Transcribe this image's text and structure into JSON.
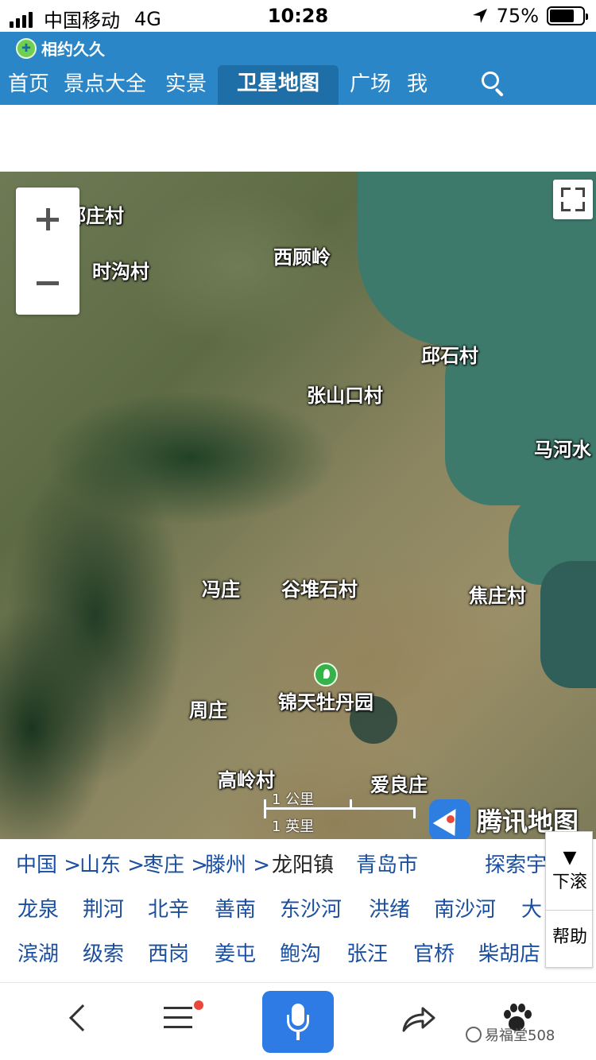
{
  "status_bar": {
    "carrier": "中国移动",
    "network": "4G",
    "time": "10:28",
    "battery_text": "75%",
    "battery_level": 0.75,
    "icons": [
      "signal-icon",
      "location-arrow-icon",
      "battery-icon"
    ]
  },
  "header": {
    "brand": "相约久久",
    "nav": [
      {
        "label": "首页"
      },
      {
        "label": "景点大全"
      },
      {
        "label": "实景"
      },
      {
        "label": "卫星地图",
        "active": true
      },
      {
        "label": "广场"
      },
      {
        "label": "我"
      }
    ],
    "accent_color": "#2a86c6",
    "active_color": "#1e6fa8"
  },
  "map": {
    "labels": [
      {
        "text": "郝庄村"
      },
      {
        "text": "时沟村"
      },
      {
        "text": "西顾岭"
      },
      {
        "text": "邱石村"
      },
      {
        "text": "张山口村"
      },
      {
        "text": "马河水"
      },
      {
        "text": "冯庄"
      },
      {
        "text": "谷堆石村"
      },
      {
        "text": "焦庄村"
      },
      {
        "text": "锦天牡丹园"
      },
      {
        "text": "周庄"
      },
      {
        "text": "高岭村"
      },
      {
        "text": "爱良庄"
      }
    ],
    "zoom_in": "+",
    "zoom_out": "−",
    "scale": {
      "metric": "1 公里",
      "imperial": "1 英里"
    },
    "provider": "腾讯地图"
  },
  "links": {
    "breadcrumb": [
      {
        "text": "中国 >"
      },
      {
        "text": "山东 >"
      },
      {
        "text": "枣庄 >"
      },
      {
        "text": "滕州 >"
      },
      {
        "text": "龙阳镇"
      },
      {
        "text": "青岛市"
      },
      {
        "text": "探索宇"
      }
    ],
    "row2": [
      "龙泉",
      "荆河",
      "北辛",
      "善南",
      "东沙河",
      "洪绪",
      "南沙河",
      "大"
    ],
    "row3": [
      "滨湖",
      "级索",
      "西岗",
      "姜屯",
      "鲍沟",
      "张汪",
      "官桥",
      "柴胡店"
    ],
    "link_color": "#1a4fa0"
  },
  "float_panel": {
    "scroll_down_arrow": "▼",
    "scroll_down": "下滚",
    "help": "帮助"
  },
  "toolbar": {
    "items": [
      "back-icon",
      "menu-icon",
      "voice-icon",
      "share-icon",
      "paw-icon"
    ],
    "watermark": "易福堂508",
    "mic_color": "#2f7be6"
  }
}
